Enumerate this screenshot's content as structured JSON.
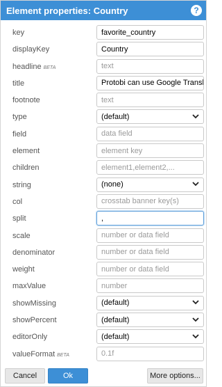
{
  "dialog": {
    "title": "Element properties: Country",
    "help_icon_glyph": "?"
  },
  "beta_tag": "BETA",
  "fields": [
    {
      "label": "key",
      "value": "favorite_country",
      "placeholder": "",
      "kind": "input"
    },
    {
      "label": "displayKey",
      "value": "Country",
      "placeholder": "",
      "kind": "input"
    },
    {
      "label": "headline",
      "beta": true,
      "value": "",
      "placeholder": "text",
      "kind": "input"
    },
    {
      "label": "title",
      "value": "Protobi can use Google Transl",
      "placeholder": "",
      "kind": "input"
    },
    {
      "label": "footnote",
      "value": "",
      "placeholder": "text",
      "kind": "input"
    },
    {
      "label": "type",
      "value": "(default)",
      "placeholder": "",
      "kind": "select"
    },
    {
      "label": "field",
      "value": "",
      "placeholder": "data field",
      "kind": "input"
    },
    {
      "label": "element",
      "value": "",
      "placeholder": "element key",
      "kind": "input"
    },
    {
      "label": "children",
      "value": "",
      "placeholder": "element1,element2,...",
      "kind": "input"
    },
    {
      "label": "string",
      "value": "(none)",
      "placeholder": "",
      "kind": "select"
    },
    {
      "label": "col",
      "value": "",
      "placeholder": "crosstab banner key(s)",
      "kind": "input"
    },
    {
      "label": "split",
      "value": ",",
      "placeholder": "",
      "kind": "input",
      "focused": true
    },
    {
      "label": "scale",
      "value": "",
      "placeholder": "number or data field",
      "kind": "input"
    },
    {
      "label": "denominator",
      "value": "",
      "placeholder": "number or data field",
      "kind": "input"
    },
    {
      "label": "weight",
      "value": "",
      "placeholder": "number or data field",
      "kind": "input"
    },
    {
      "label": "maxValue",
      "value": "",
      "placeholder": "number",
      "kind": "input"
    },
    {
      "label": "showMissing",
      "value": "(default)",
      "placeholder": "",
      "kind": "select"
    },
    {
      "label": "showPercent",
      "value": "(default)",
      "placeholder": "",
      "kind": "select"
    },
    {
      "label": "editorOnly",
      "value": "(default)",
      "placeholder": "",
      "kind": "select"
    },
    {
      "label": "valueFormat",
      "beta": true,
      "value": "",
      "placeholder": "0.1f",
      "kind": "input"
    }
  ],
  "buttons": {
    "cancel": "Cancel",
    "ok": "Ok",
    "more": "More options..."
  },
  "colors": {
    "accent": "#3d8fd6",
    "focus_border": "#5b9dd9"
  }
}
